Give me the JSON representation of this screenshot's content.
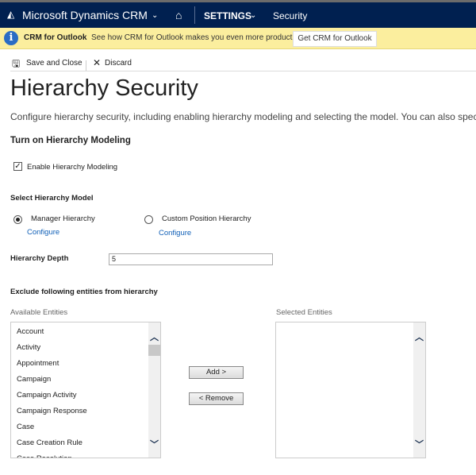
{
  "nav": {
    "app_title": "Microsoft Dynamics CRM",
    "area": "SETTINGS",
    "page": "Security"
  },
  "info_bar": {
    "title": "CRM for Outlook",
    "message": "See how CRM for Outlook makes you even more productive.",
    "button": "Get CRM for Outlook"
  },
  "toolbar": {
    "save_close": "Save and Close",
    "discard": "Discard"
  },
  "page": {
    "title": "Hierarchy Security",
    "description": "Configure hierarchy security, including enabling hierarchy modeling and selecting the model. You can also specify h"
  },
  "modeling": {
    "heading": "Turn on Hierarchy Modeling",
    "checkbox_label": "Enable Hierarchy Modeling",
    "checked": true
  },
  "model": {
    "heading": "Select Hierarchy Model",
    "options": [
      {
        "label": "Manager Hierarchy",
        "link": "Configure",
        "selected": true
      },
      {
        "label": "Custom Position Hierarchy",
        "link": "Configure",
        "selected": false
      }
    ]
  },
  "depth": {
    "label": "Hierarchy Depth",
    "value": "5"
  },
  "exclude": {
    "heading": "Exclude following entities from hierarchy",
    "available_label": "Available Entities",
    "selected_label": "Selected Entities",
    "available": [
      "Account",
      "Activity",
      "Appointment",
      "Campaign",
      "Campaign Activity",
      "Campaign Response",
      "Case",
      "Case Creation Rule",
      "Case Resolution"
    ],
    "selected": [],
    "add": "Add >",
    "remove": "< Remove"
  }
}
